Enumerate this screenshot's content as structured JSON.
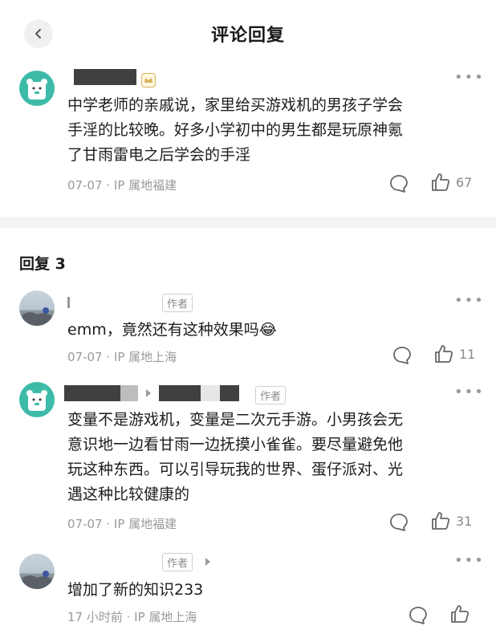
{
  "header": {
    "title": "评论回复"
  },
  "main_comment": {
    "text_lines": [
      "中学老师的亲戚说，家里给买游戏机的男孩子学会",
      "手淫的比较晚。好多小学初中的男生都是玩原神氪",
      "了甘雨雷电之后学会的手淫"
    ],
    "date": "07-07",
    "location": "· IP 属地福建",
    "likes": "67"
  },
  "replies_heading": "回复 3",
  "replies": [
    {
      "author_tag": "作者",
      "text": "emm，竟然还有这种效果吗😂",
      "date": "07-07",
      "location": "· IP 属地上海",
      "likes": "11"
    },
    {
      "author_tag": "作者",
      "text_lines": [
        "变量不是游戏机，变量是二次元手游。小男孩会无",
        "意识地一边看甘雨一边抚摸小雀雀。要尽量避免他",
        "玩这种东西。可以引导玩我的世界、蛋仔派对、光",
        "遇这种比较健康的"
      ],
      "date": "07-07",
      "location": "· IP 属地福建",
      "likes": "31"
    },
    {
      "author_tag": "作者",
      "text": "增加了新的知识233",
      "date": "17 小时前",
      "location": "· IP 属地上海"
    }
  ],
  "icons": {
    "back": "chevron-left-icon",
    "more": "more-icon",
    "comment": "comment-icon",
    "like": "thumb-up-icon",
    "badge": "crown-badge-icon"
  },
  "colors": {
    "avatar_teal": "#3dbba8",
    "meta_gray": "#9a9a9a",
    "divider": "#f4f4f4"
  }
}
